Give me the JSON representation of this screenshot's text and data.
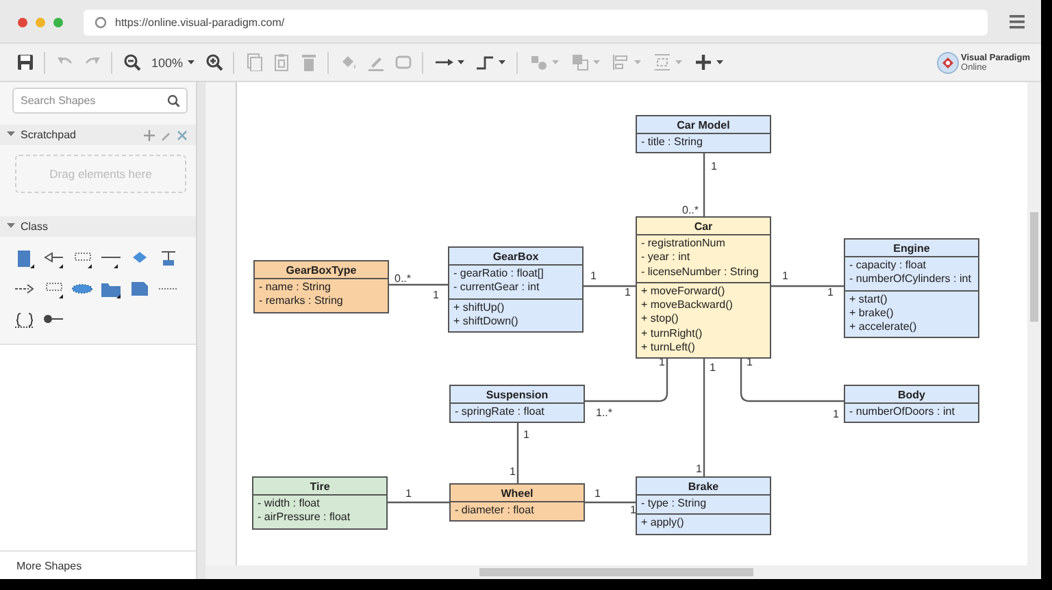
{
  "browser": {
    "url": "https://online.visual-paradigm.com/"
  },
  "toolbar": {
    "tools": [
      {
        "kind": "save",
        "disabled": false
      },
      {
        "kind": "separator"
      },
      {
        "kind": "undo",
        "disabled": true
      },
      {
        "kind": "redo",
        "disabled": true
      },
      {
        "kind": "separator"
      },
      {
        "kind": "zoom-out",
        "disabled": false
      },
      {
        "kind": "zoom-level",
        "label": "100%",
        "dropdown": true,
        "disabled": false
      },
      {
        "kind": "zoom-in",
        "disabled": false
      },
      {
        "kind": "separator"
      },
      {
        "kind": "copy",
        "disabled": true
      },
      {
        "kind": "paste",
        "disabled": true
      },
      {
        "kind": "delete",
        "disabled": true
      },
      {
        "kind": "separator"
      },
      {
        "kind": "fill",
        "disabled": true
      },
      {
        "kind": "line-color",
        "disabled": true
      },
      {
        "kind": "shadow",
        "disabled": true
      },
      {
        "kind": "separator"
      },
      {
        "kind": "connector",
        "dropdown": true,
        "disabled": false
      },
      {
        "kind": "waypoint",
        "dropdown": true,
        "disabled": false
      },
      {
        "kind": "separator"
      },
      {
        "kind": "arrange",
        "dropdown": true,
        "disabled": true
      },
      {
        "kind": "to-front",
        "dropdown": true,
        "disabled": true
      },
      {
        "kind": "align",
        "dropdown": true,
        "disabled": true
      },
      {
        "kind": "distribute",
        "dropdown": true,
        "disabled": true
      },
      {
        "kind": "insert",
        "dropdown": true,
        "disabled": false
      }
    ],
    "logo": {
      "name": "Visual Paradigm",
      "subtitle": "Online"
    }
  },
  "sidebar": {
    "search": {
      "placeholder": "Search Shapes"
    },
    "sections": [
      {
        "kind": "scratchpad",
        "title": "Scratchpad",
        "expanded": true,
        "hint": "Drag elements here"
      },
      {
        "kind": "shapes",
        "title": "Class",
        "expanded": true
      }
    ],
    "footer": "More Shapes"
  },
  "diagram": {
    "classes": [
      {
        "name": "Car Model",
        "color": "#dae8fc",
        "attributes": [
          "- title : String"
        ]
      },
      {
        "name": "GearBoxType",
        "color": "#f9d0a2",
        "attributes": [
          "- name : String",
          "- remarks : String"
        ]
      },
      {
        "name": "GearBox",
        "color": "#dae8fc",
        "attributes": [
          "- gearRatio : float[]",
          "- currentGear : int"
        ],
        "operations": [
          "+ shiftUp()",
          "+ shiftDown()"
        ]
      },
      {
        "name": "Car",
        "color": "#fff2cc",
        "attributes": [
          "- registrationNum",
          "- year : int",
          "- licenseNumber : String"
        ],
        "operations": [
          "+ moveForward()",
          "+ moveBackward()",
          "+ stop()",
          "+ turnRight()",
          "+ turnLeft()"
        ]
      },
      {
        "name": "Engine",
        "color": "#dae8fc",
        "attributes": [
          "- capacity : float",
          "- numberOfCylinders : int"
        ],
        "operations": [
          "+ start()",
          "+ brake()",
          "+ accelerate()"
        ]
      },
      {
        "name": "Suspension",
        "color": "#dae8fc",
        "attributes": [
          "- springRate : float"
        ]
      },
      {
        "name": "Body",
        "color": "#dae8fc",
        "attributes": [
          "- numberOfDoors : int"
        ]
      },
      {
        "name": "Tire",
        "color": "#d5e8d4",
        "attributes": [
          "- width : float",
          "- airPressure : float"
        ]
      },
      {
        "name": "Wheel",
        "color": "#f9d0a2",
        "attributes": [
          "- diameter : float"
        ]
      },
      {
        "name": "Brake",
        "color": "#dae8fc",
        "attributes": [
          "- type : String"
        ],
        "operations": [
          "+ apply()"
        ]
      }
    ],
    "associations": [
      {
        "labels": [
          "1",
          "0..*"
        ]
      },
      {
        "labels": [
          "0..*",
          "1"
        ]
      },
      {
        "labels": [
          "1",
          "1"
        ]
      },
      {
        "labels": [
          "1",
          "1"
        ]
      },
      {
        "labels": [
          "1",
          "1..*"
        ]
      },
      {
        "labels": [
          "1",
          "1"
        ]
      },
      {
        "labels": [
          "1",
          "1"
        ]
      },
      {
        "labels": [
          "1",
          "1"
        ]
      },
      {
        "labels": [
          "1"
        ]
      },
      {
        "labels": [
          "1",
          "1"
        ]
      }
    ]
  }
}
